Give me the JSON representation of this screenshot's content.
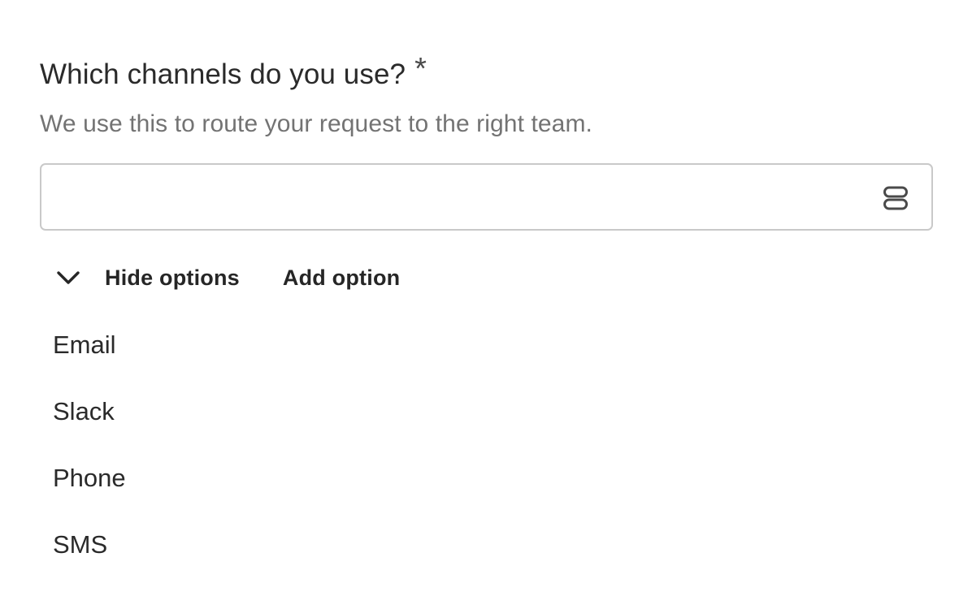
{
  "form": {
    "question": "Which channels do you use?",
    "required_mark": "*",
    "description": "We use this to route your request to the right team.",
    "select": {
      "value": "",
      "icon": "list-layout-icon"
    },
    "toolbar": {
      "toggle_icon": "chevron-down-icon",
      "hide_options_label": "Hide options",
      "add_option_label": "Add option"
    },
    "options": [
      {
        "label": "Email"
      },
      {
        "label": "Slack"
      },
      {
        "label": "Phone"
      },
      {
        "label": "SMS"
      }
    ]
  }
}
